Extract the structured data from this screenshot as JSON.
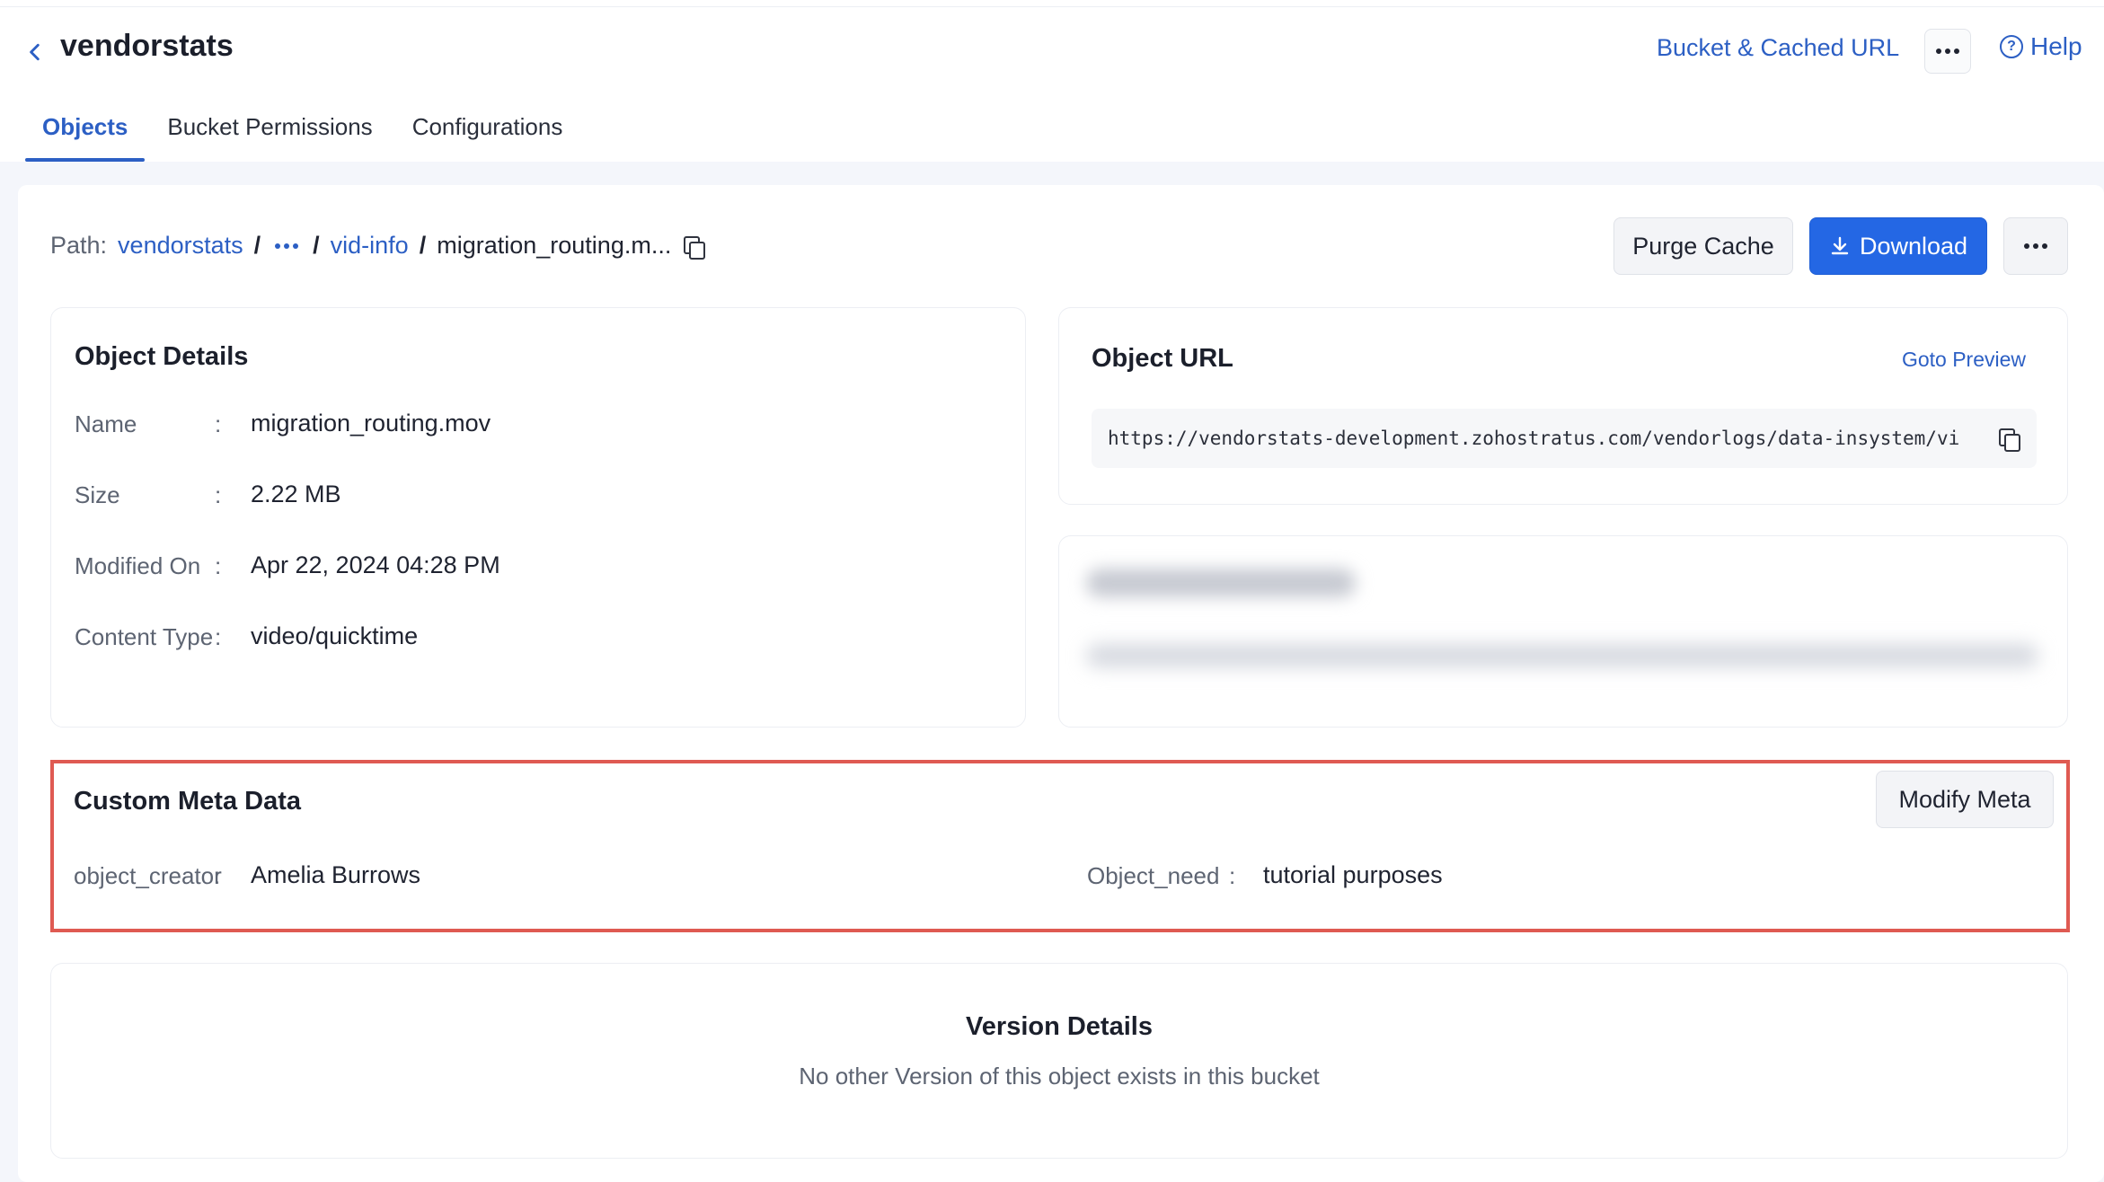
{
  "header": {
    "title": "vendorstats",
    "bucket_link": "Bucket & Cached URL",
    "help": "Help",
    "help_glyph": "?"
  },
  "tabs": [
    {
      "label": "Objects",
      "active": true
    },
    {
      "label": "Bucket Permissions",
      "active": false
    },
    {
      "label": "Configurations",
      "active": false
    }
  ],
  "path": {
    "label": "Path:",
    "root": "vendorstats",
    "folder": "vid-info",
    "current": "migration_routing.m...",
    "separator": "/"
  },
  "actions": {
    "purge": "Purge Cache",
    "download": "Download"
  },
  "object_details": {
    "title": "Object Details",
    "colon": ":",
    "rows": [
      {
        "label": "Name",
        "value": "migration_routing.mov"
      },
      {
        "label": "Size",
        "value": "2.22 MB"
      },
      {
        "label": "Modified On",
        "value": "Apr 22, 2024 04:28 PM"
      },
      {
        "label": "Content Type",
        "value": "video/quicktime"
      }
    ]
  },
  "object_url": {
    "title": "Object URL",
    "goto": "Goto Preview",
    "url": "https://vendorstats-development.zohostratus.com/vendorlogs/data-insystem/vi"
  },
  "custom_meta": {
    "title": "Custom Meta Data",
    "modify": "Modify Meta",
    "colon": ":",
    "entries": [
      {
        "key": "object_creator",
        "value": "Amelia Burrows"
      },
      {
        "key": "Object_need",
        "value": "tutorial purposes"
      }
    ]
  },
  "version": {
    "title": "Version Details",
    "message": "No other Version of this object exists in this bucket"
  },
  "colors": {
    "accent": "#2c5fc4",
    "primary_button": "#2467e4",
    "highlight_border": "#df5a52"
  }
}
